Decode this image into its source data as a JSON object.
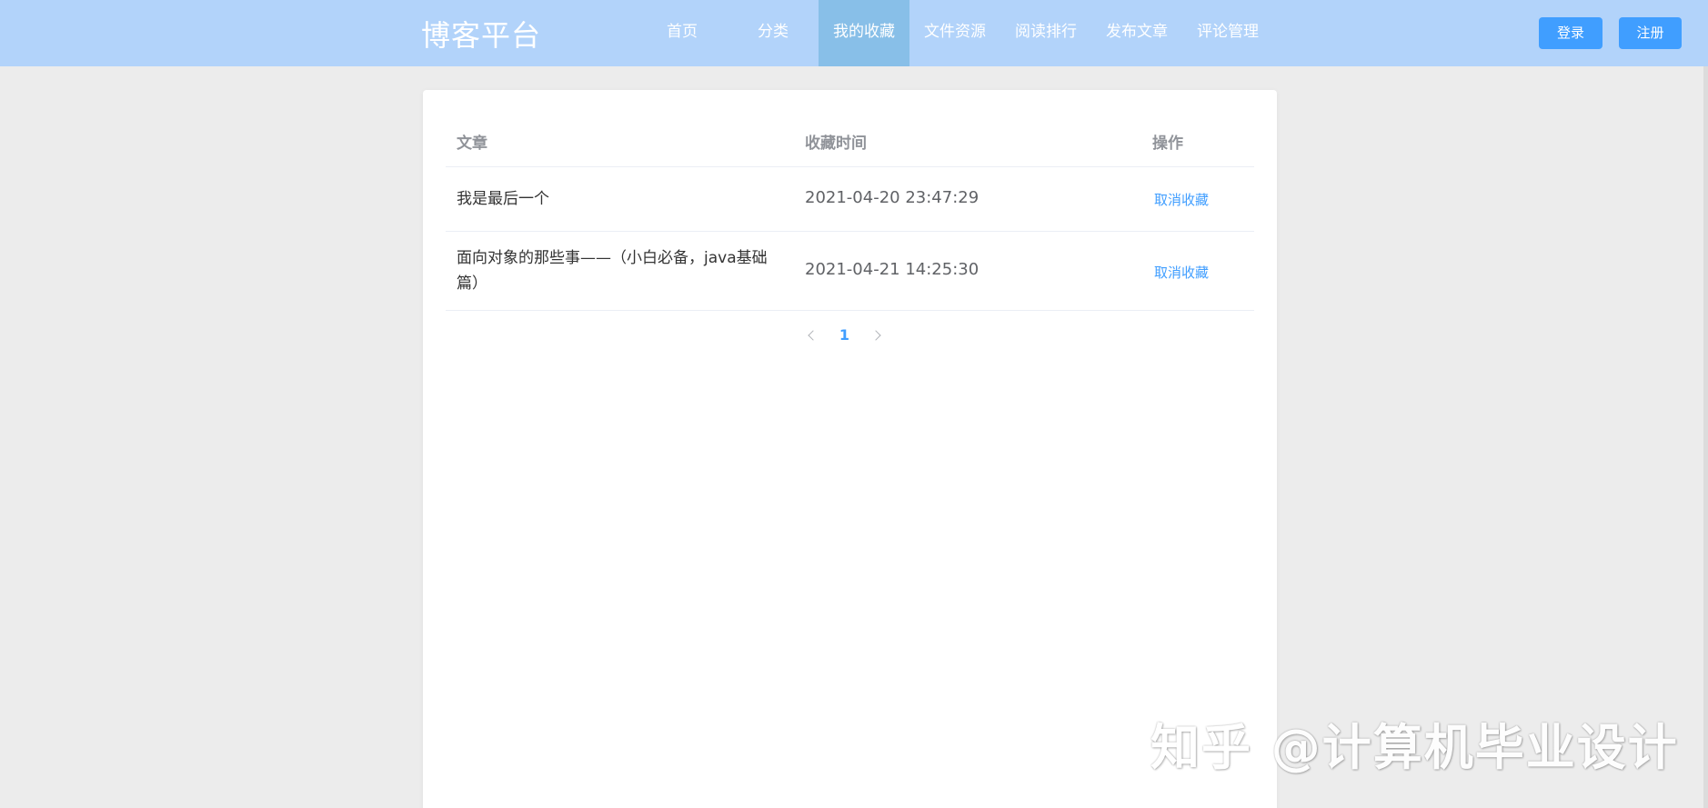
{
  "header": {
    "brand": "博客平台",
    "nav": [
      {
        "label": "首页",
        "active": false
      },
      {
        "label": "分类",
        "active": false
      },
      {
        "label": "我的收藏",
        "active": true
      },
      {
        "label": "文件资源",
        "active": false
      },
      {
        "label": "阅读排行",
        "active": false
      },
      {
        "label": "发布文章",
        "active": false
      },
      {
        "label": "评论管理",
        "active": false
      }
    ],
    "login_label": "登录",
    "register_label": "注册"
  },
  "table": {
    "columns": [
      "文章",
      "收藏时间",
      "操作"
    ],
    "rows": [
      {
        "title": "我是最后一个",
        "time": "2021-04-20 23:47:29",
        "action": "取消收藏"
      },
      {
        "title": "面向对象的那些事——（小白必备，java基础篇）",
        "time": "2021-04-21 14:25:30",
        "action": "取消收藏"
      }
    ]
  },
  "pagination": {
    "current_page": "1"
  },
  "watermark": "知乎 @计算机毕业设计",
  "colors": {
    "header_bg": "#b2d3fa",
    "nav_active_bg": "#88bfe8",
    "primary": "#409eff",
    "page_bg": "#ececec"
  },
  "icons": {
    "prev": "chevron-left-icon",
    "next": "chevron-right-icon"
  }
}
